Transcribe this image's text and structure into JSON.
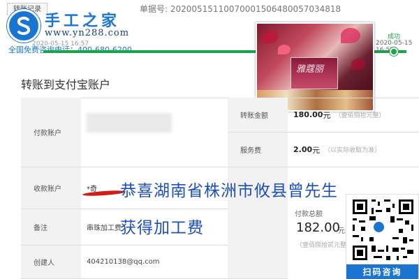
{
  "header": {
    "tab_label": "转账记录",
    "order_number": "单据号: 20200515110070001506480057034818"
  },
  "watermark": {
    "site_name": "手工之家",
    "site_url": "www.yn288.com",
    "hotline": "全国免费咨询电话：400-680-6200",
    "brand_color": "#1a75d2"
  },
  "progress": {
    "start_date": "2020-05-15 16:57",
    "end_status": "成功",
    "end_date": "2020-05-15 16:57",
    "color": "#19a64a"
  },
  "photo": {
    "caption": "雅蔻丽"
  },
  "page": {
    "title": "转账到支付宝账户"
  },
  "form": {
    "payer_label": "付款账户",
    "receiver_label": "收款账户",
    "receiver_prefix": "*奇",
    "note_label": "备注",
    "note_value": "串珠加工费",
    "creator_label": "创建人",
    "creator_value": "404210138@qq.com",
    "amount_label": "转账金额",
    "amount_value": "180.00",
    "amount_unit": "元",
    "amount_words": "（壹佰捌拾元整）",
    "fee_label": "服务费",
    "fee_value": "2.00",
    "fee_unit": "元",
    "fee_note": "（以实际收取为准）",
    "total_label": "付款总额",
    "total_value": "182.00",
    "total_unit": "元",
    "total_words": "（壹佰捌拾贰元整）"
  },
  "overlay": {
    "line1": "恭喜湖南省株洲市攸县曾先生",
    "line2": "获得加工费",
    "text_color": "#1d4fb8"
  },
  "qr": {
    "label": "扫码咨询"
  }
}
